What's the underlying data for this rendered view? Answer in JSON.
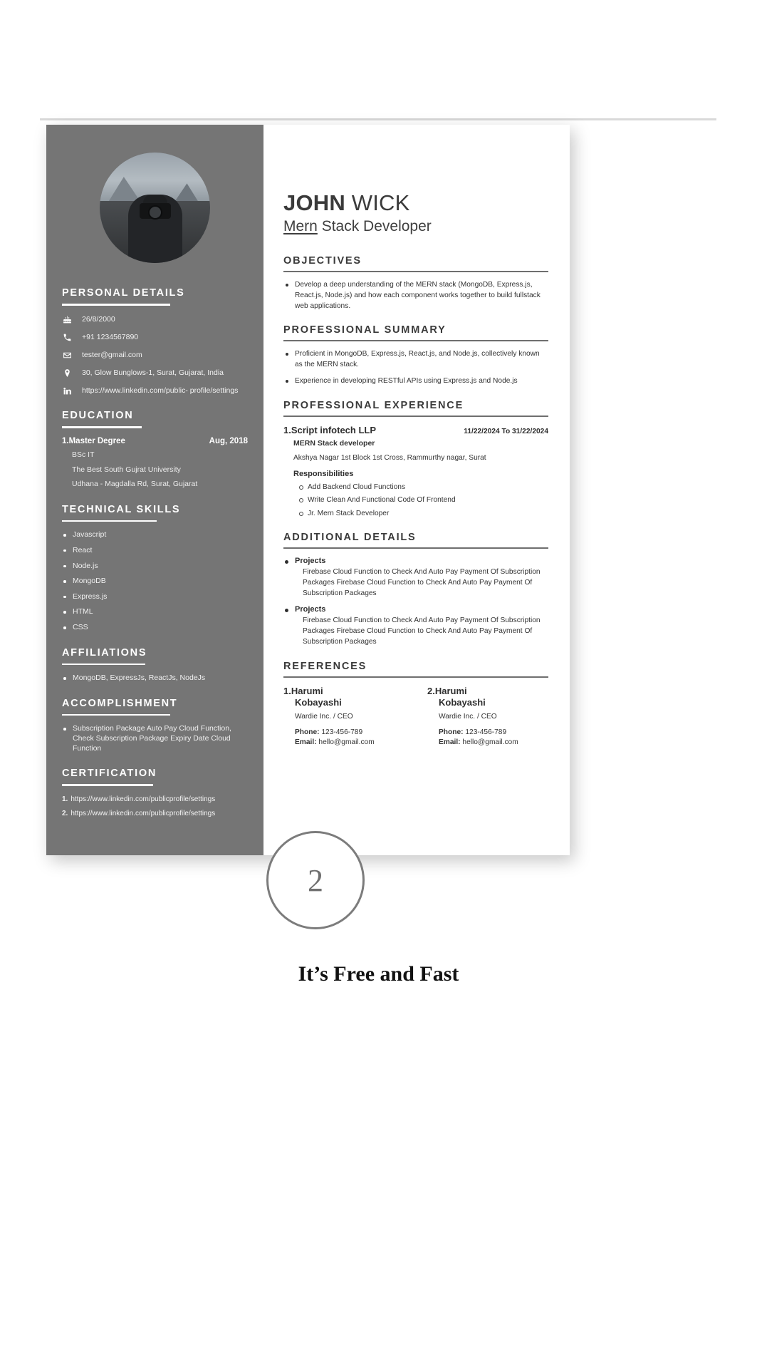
{
  "sidebar": {
    "personal_details": {
      "heading": "PERSONAL DETAILS",
      "items": [
        {
          "icon": "cake-icon",
          "value": "26/8/2000"
        },
        {
          "icon": "phone-icon",
          "value": "+91 1234567890"
        },
        {
          "icon": "envelope-icon",
          "value": "tester@gmail.com"
        },
        {
          "icon": "location-pin-icon",
          "value": "30, Glow Bunglows-1, Surat, Gujarat, India"
        },
        {
          "icon": "linkedin-icon",
          "value": "https://www.linkedin.com/public- profile/settings"
        }
      ]
    },
    "education": {
      "heading": "EDUCATION",
      "entries": [
        {
          "number": "1.",
          "degree": "Master Degree",
          "date": "Aug, 2018",
          "field": "BSc IT",
          "institution": "The Best South Gujrat University",
          "address": "Udhana - Magdalla Rd, Surat, Gujarat"
        }
      ]
    },
    "technical_skills": {
      "heading": "TECHNICAL SKILLS",
      "items": [
        "Javascript",
        "React",
        "Node.js",
        "MongoDB",
        "Express.js",
        "HTML",
        "CSS"
      ]
    },
    "affiliations": {
      "heading": "AFFILIATIONS",
      "items": [
        "MongoDB, ExpressJs, ReactJs, NodeJs"
      ]
    },
    "accomplishment": {
      "heading": "ACCOMPLISHMENT",
      "items": [
        "Subscription Package Auto Pay Cloud Function, Check Subscription Package Expiry Date Cloud Function"
      ]
    },
    "certification": {
      "heading": "CERTIFICATION",
      "items": [
        {
          "number": "1.",
          "value": "https://www.linkedin.com/publicprofile/settings"
        },
        {
          "number": "2.",
          "value": "https://www.linkedin.com/publicprofile/settings"
        }
      ]
    }
  },
  "main": {
    "first_name": "JOHN",
    "last_name": "WICK",
    "role_underlined": "Mern",
    "role_rest": " Stack Developer",
    "objectives": {
      "heading": "OBJECTIVES",
      "items": [
        "Develop a deep understanding of the MERN stack (MongoDB, Express.js, React.js, Node.js) and how each component works together to build fullstack web applications."
      ]
    },
    "professional_summary": {
      "heading": "PROFESSIONAL SUMMARY",
      "items": [
        "Proficient in MongoDB, Express.js, React.js, and Node.js, collectively known as the MERN stack.",
        "Experience in developing RESTful APIs using Express.js and Node.js"
      ]
    },
    "professional_experience": {
      "heading": "PROFESSIONAL EXPERIENCE",
      "entries": [
        {
          "number": "1.",
          "company": "Script infotech LLP",
          "dates": "11/22/2024 To 31/22/2024",
          "role": "MERN Stack developer",
          "address": "Akshya Nagar 1st Block 1st Cross, Rammurthy nagar, Surat",
          "responsibilities_heading": "Responsibilities",
          "responsibilities": [
            "Add Backend Cloud Functions",
            "Write Clean And Functional Code Of Frontend",
            "Jr. Mern Stack Developer"
          ]
        }
      ]
    },
    "additional_details": {
      "heading": "ADDITIONAL DETAILS",
      "entries": [
        {
          "title": "Projects",
          "body": "Firebase Cloud Function to Check And Auto Pay Payment Of Subscription Packages Firebase Cloud Function to Check And Auto Pay Payment Of Subscription Packages"
        },
        {
          "title": "Projects",
          "body": "Firebase Cloud Function to Check And Auto Pay Payment Of Subscription Packages Firebase Cloud Function to Check And Auto Pay Payment Of Subscription Packages"
        }
      ]
    },
    "references": {
      "heading": "REFERENCES",
      "entries": [
        {
          "number": "1.",
          "name_line1": "Harumi",
          "name_line2": "Kobayashi",
          "company_role": "Wardie Inc. / CEO",
          "phone_label": "Phone:",
          "phone": " 123-456-789",
          "email_label": "Email:",
          "email": " hello@gmail.com"
        },
        {
          "number": "2.",
          "name_line1": "Harumi",
          "name_line2": "Kobayashi",
          "company_role": "Wardie Inc. / CEO",
          "phone_label": "Phone:",
          "phone": " 123-456-789",
          "email_label": "Email:",
          "email": " hello@gmail.com"
        }
      ]
    }
  },
  "badge": {
    "number": "2"
  },
  "tagline": "It’s Free and Fast",
  "colors": {
    "sidebar_bg": "#757575",
    "badge_border": "#7c7c7c",
    "rule": "#6f6f6f"
  }
}
